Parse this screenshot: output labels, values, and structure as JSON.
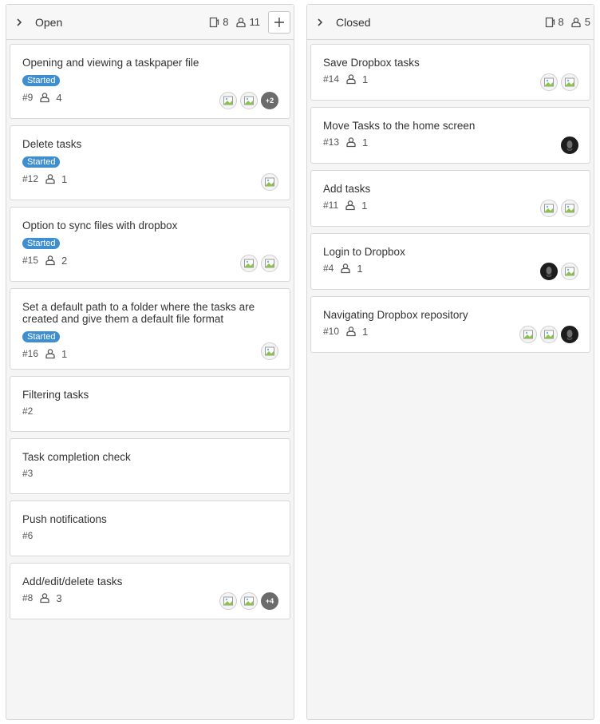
{
  "columns": [
    {
      "title": "Open",
      "task_count": "8",
      "people_count": "11",
      "cards": [
        {
          "title": "Opening and viewing a taskpaper file",
          "badge": "Started",
          "number": "#9",
          "people": "4",
          "avatars": [
            "image",
            "image",
            "+2"
          ]
        },
        {
          "title": "Delete tasks",
          "badge": "Started",
          "number": "#12",
          "people": "1",
          "avatars": [
            "image"
          ]
        },
        {
          "title": "Option to sync files with dropbox",
          "badge": "Started",
          "number": "#15",
          "people": "2",
          "avatars": [
            "image",
            "image"
          ]
        },
        {
          "title": "Set a default path to a folder where the tasks are created and give them a default file format",
          "badge": "Started",
          "number": "#16",
          "people": "1",
          "avatars": [
            "image"
          ]
        },
        {
          "title": "Filtering tasks",
          "number": "#2"
        },
        {
          "title": "Task completion check",
          "number": "#3"
        },
        {
          "title": "Push notifications",
          "number": "#6"
        },
        {
          "title": "Add/edit/delete tasks",
          "number": "#8",
          "people": "3",
          "avatars": [
            "image",
            "image",
            "+4"
          ]
        }
      ]
    },
    {
      "title": "Closed",
      "task_count": "8",
      "people_count": "5",
      "cards": [
        {
          "title": "Save Dropbox tasks",
          "number": "#14",
          "people": "1",
          "avatars": [
            "image",
            "image"
          ]
        },
        {
          "title": "Move Tasks to the home screen",
          "number": "#13",
          "people": "1",
          "avatars": [
            "dark"
          ]
        },
        {
          "title": "Add tasks",
          "number": "#11",
          "people": "1",
          "avatars": [
            "image",
            "image"
          ]
        },
        {
          "title": "Login to Dropbox",
          "number": "#4",
          "people": "1",
          "avatars": [
            "dark",
            "image"
          ]
        },
        {
          "title": "Navigating Dropbox repository",
          "number": "#10",
          "people": "1",
          "avatars": [
            "image",
            "image",
            "dark"
          ]
        }
      ]
    }
  ],
  "icons": {
    "chevron": "chevron-right-icon",
    "task": "task-icon",
    "people": "person-icon",
    "add": "plus-icon"
  },
  "colors": {
    "badge": "#3e8ed0",
    "more_avatar": "#6b6b6b",
    "dark_avatar": "#1d1d1d"
  }
}
